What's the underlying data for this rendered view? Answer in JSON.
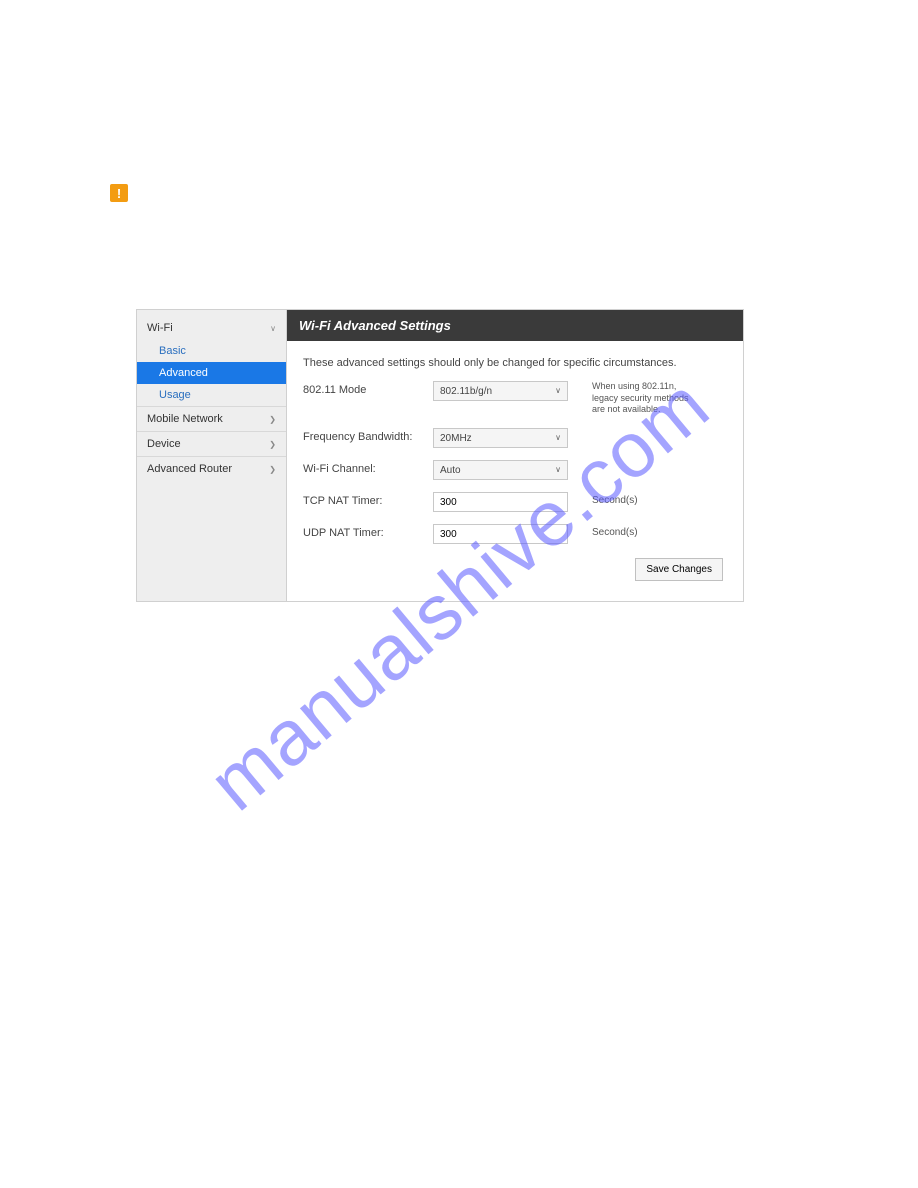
{
  "caution_glyph": "!",
  "sidebar": {
    "wifi_label": "Wi-Fi",
    "basic_label": "Basic",
    "advanced_label": "Advanced",
    "usage_label": "Usage",
    "mobile_label": "Mobile Network",
    "device_label": "Device",
    "router_label": "Advanced Router"
  },
  "content": {
    "header": "Wi-Fi Advanced Settings",
    "intro": "These advanced settings should only be changed for specific circumstances.",
    "mode_label": "802.11 Mode",
    "mode_value": "802.11b/g/n",
    "mode_note": "When using 802.11n, legacy security methods are not available.",
    "bandwidth_label": "Frequency Bandwidth:",
    "bandwidth_value": "20MHz",
    "channel_label": "Wi-Fi Channel:",
    "channel_value": "Auto",
    "tcp_label": "TCP NAT Timer:",
    "tcp_value": "300",
    "tcp_suffix": "Second(s)",
    "udp_label": "UDP NAT Timer:",
    "udp_value": "300",
    "udp_suffix": "Second(s)",
    "save_label": "Save Changes"
  },
  "watermark": "manualshive.com"
}
